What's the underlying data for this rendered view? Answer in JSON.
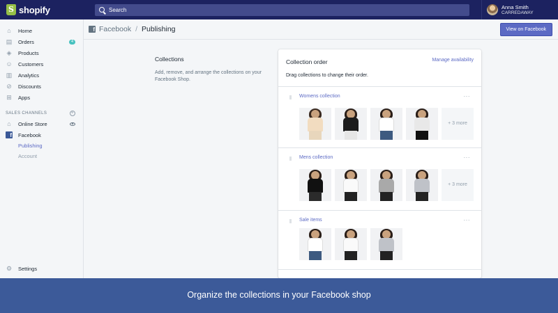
{
  "topbar": {
    "brand": "shopify",
    "search_placeholder": "Search",
    "user_name": "Anna Smith",
    "store_name": "CARREDAWAY"
  },
  "sidebar": {
    "items": [
      {
        "label": "Home",
        "icon": "home-icon"
      },
      {
        "label": "Orders",
        "icon": "orders-icon",
        "badge": "4"
      },
      {
        "label": "Products",
        "icon": "tag-icon"
      },
      {
        "label": "Customers",
        "icon": "person-icon"
      },
      {
        "label": "Analytics",
        "icon": "chart-icon"
      },
      {
        "label": "Discounts",
        "icon": "discount-icon"
      },
      {
        "label": "Apps",
        "icon": "apps-icon"
      }
    ],
    "sales_channels_label": "SALES CHANNELS",
    "channels": [
      {
        "label": "Online Store",
        "icon": "store-icon"
      },
      {
        "label": "Facebook",
        "icon": "facebook-icon"
      }
    ],
    "facebook_sub": [
      "Publishing",
      "Account"
    ],
    "settings_label": "Settings"
  },
  "header": {
    "crumb_parent": "Facebook",
    "crumb_current": "Publishing",
    "view_button": "View on Facebook"
  },
  "description": {
    "title": "Collections",
    "text": "Add, remove, and arrange the collections on your Facebook Shop."
  },
  "card": {
    "title": "Collection order",
    "manage_link": "Manage availability",
    "subtitle": "Drag collections to change their order.",
    "collections": [
      {
        "name": "Womens collection",
        "more": "+ 3 more"
      },
      {
        "name": "Mens collection",
        "more": "+ 3 more"
      },
      {
        "name": "Sale items"
      }
    ],
    "more_menu": "···"
  },
  "banner": {
    "text": "Organize the collections in your Facebook shop"
  },
  "colors": {
    "topbar": "#1c2260",
    "accent": "#5c6ac4",
    "banner": "#3c5a99",
    "badge": "#47c1bf"
  }
}
